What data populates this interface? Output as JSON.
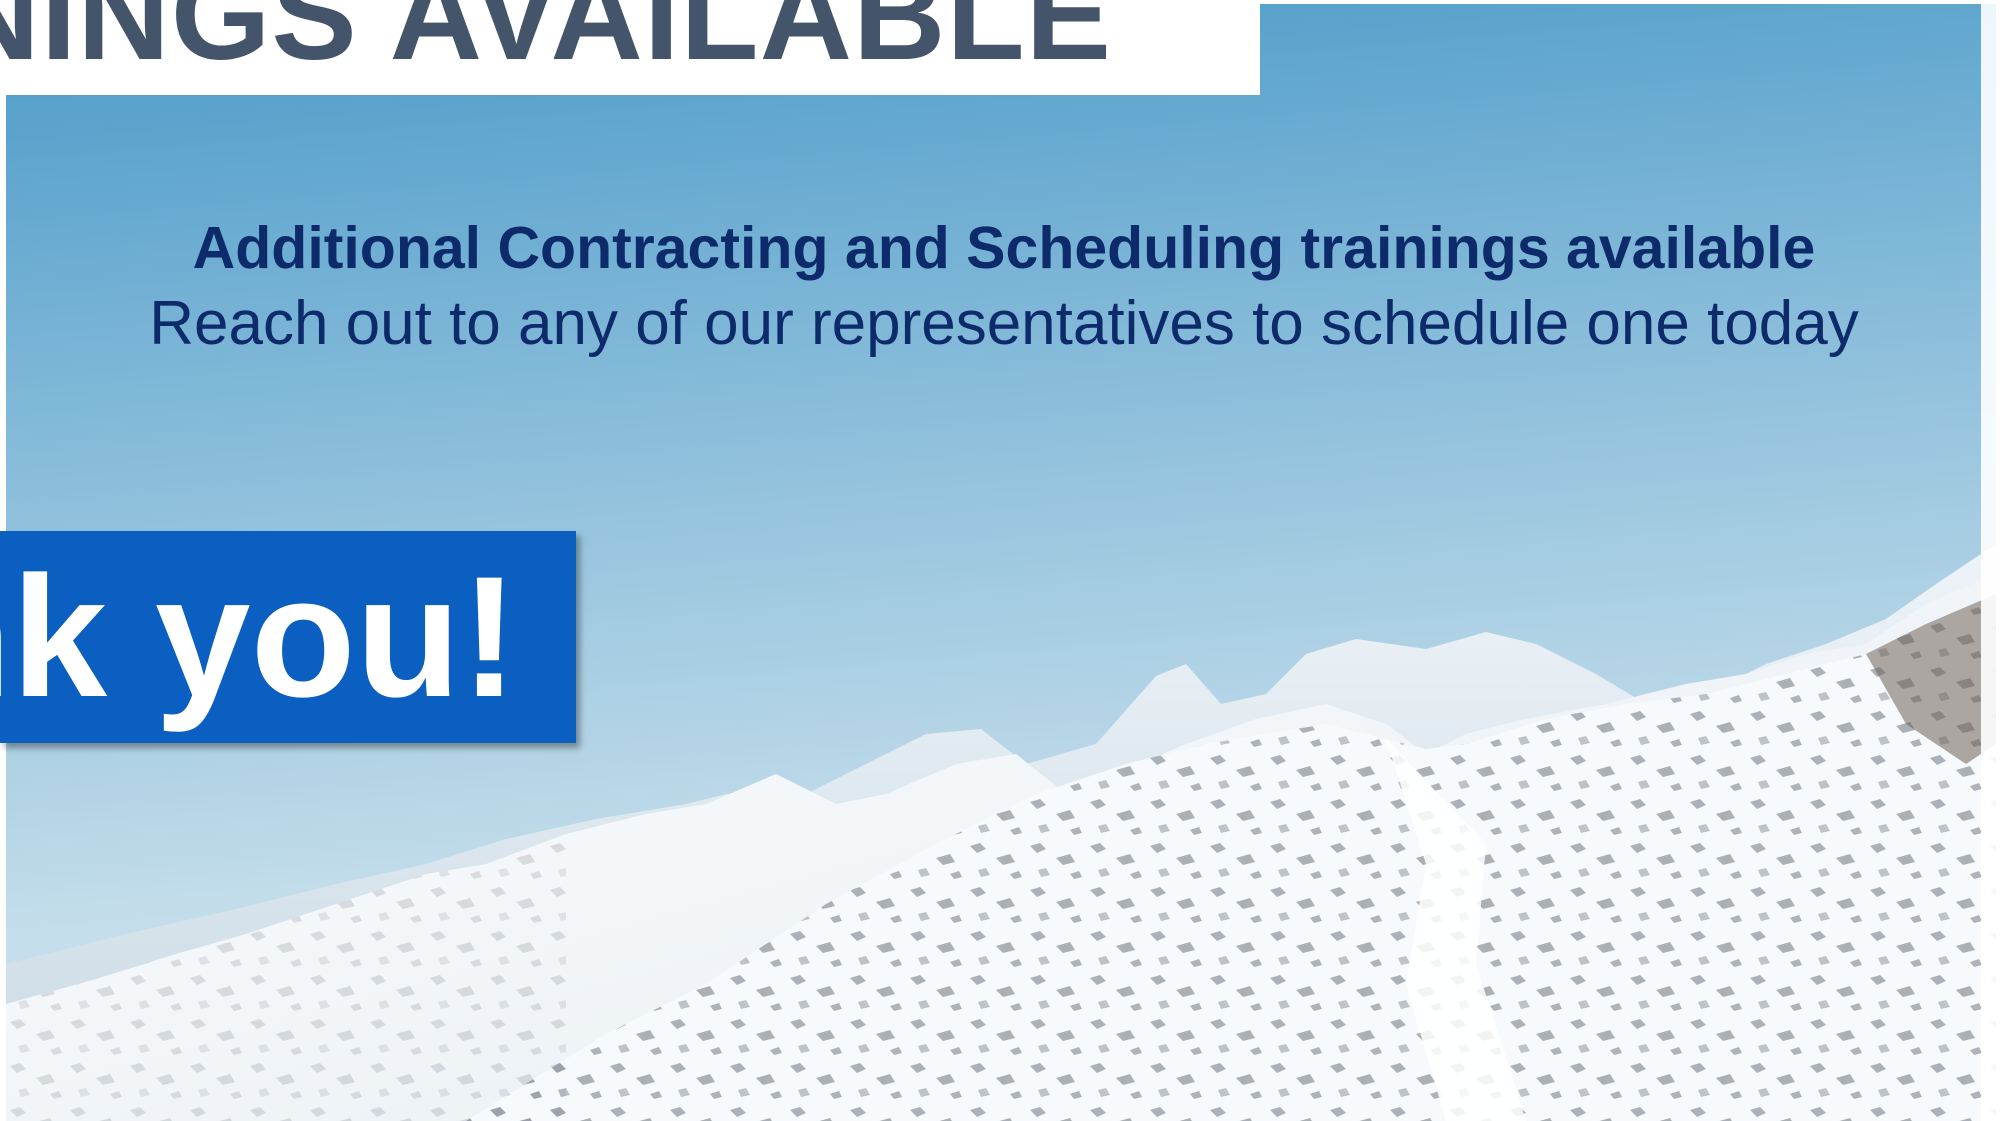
{
  "slide": {
    "title": "TRAININGS AVAILABLE",
    "headline": "Additional Contracting and Scheduling trainings available",
    "subline": "Reach out to any of our representatives to schedule one today",
    "callout": "Thank you!"
  },
  "colors": {
    "title": "#44546a",
    "headline": "#0d2b6b",
    "callout_background": "#0a5fc0",
    "callout_text": "#ffffff",
    "sky_top": "#4a9ac8",
    "sky_bottom": "#c2dcea"
  }
}
